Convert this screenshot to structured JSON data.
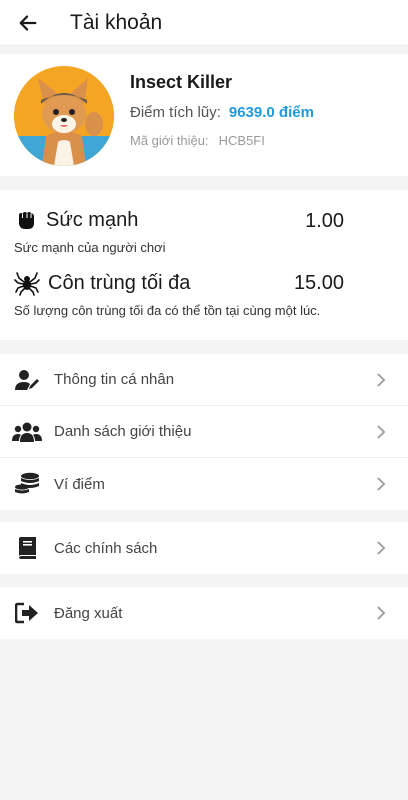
{
  "header": {
    "title": "Tài khoản"
  },
  "profile": {
    "name": "Insect Killer",
    "points_label": "Điểm tích lũy:",
    "points_value": "9639.0 điểm",
    "referral_label": "Mã giới thiệu:",
    "referral_code": "HCB5FI"
  },
  "stats": [
    {
      "title": "Sức mạnh",
      "value": "1.00",
      "description": "Sức mạnh của người chơi"
    },
    {
      "title": "Côn trùng tối đa",
      "value": "15.00",
      "description": "Số lượng côn trùng tối đa có thể tồn tại cùng một lúc."
    }
  ],
  "menu_group_1": [
    {
      "label": "Thông tin cá nhân",
      "icon": "user-edit-icon"
    },
    {
      "label": "Danh sách giới thiệu",
      "icon": "users-icon"
    },
    {
      "label": "Ví điểm",
      "icon": "coins-icon"
    }
  ],
  "menu_group_2": [
    {
      "label": "Các chính sách",
      "icon": "book-icon"
    }
  ],
  "menu_group_3": [
    {
      "label": "Đăng xuất",
      "icon": "logout-icon"
    }
  ],
  "colors": {
    "accent": "#1e9be0",
    "background": "#f4f4f4"
  }
}
